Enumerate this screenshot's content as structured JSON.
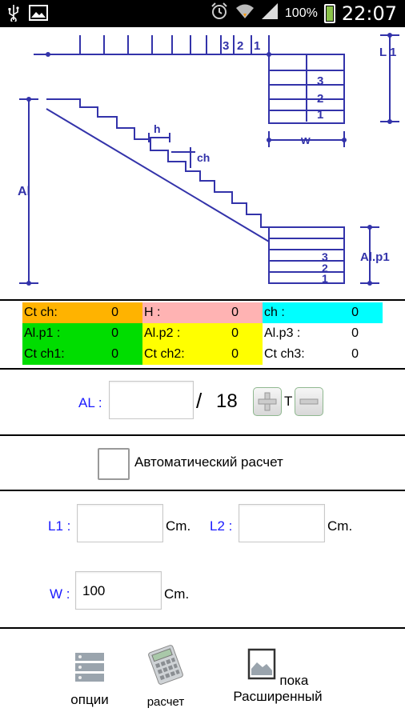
{
  "status_bar": {
    "battery": "100%",
    "time": "22:07",
    "icons": [
      "usb-icon",
      "image-icon",
      "alarm-icon",
      "wifi-icon",
      "signal-icon",
      "battery-icon"
    ]
  },
  "diagram": {
    "labels": {
      "L1": "L 1",
      "w": "w",
      "h": "h",
      "ch": "ch",
      "Al": "Al",
      "Alp1": "Al.p1",
      "top_steps": [
        "3",
        "2",
        "1"
      ],
      "right_steps": [
        "3",
        "2",
        "1"
      ],
      "bottom_steps": [
        "3",
        "2",
        "1"
      ]
    },
    "color": "#3333aa"
  },
  "table": {
    "rows": [
      [
        {
          "label": "Ct ch:",
          "value": "0",
          "bg": "#ffb300"
        },
        {
          "label": "H :",
          "value": "0",
          "bg": "#ffb3b3"
        },
        {
          "label": "ch :",
          "value": "0",
          "bg": "#00ffff"
        }
      ],
      [
        {
          "label": "Al.p1 :",
          "value": "0",
          "bg": "#00dd00"
        },
        {
          "label": "Al.p2 :",
          "value": "0",
          "bg": "#ffff00"
        },
        {
          "label": "Al.p3 :",
          "value": "0",
          "bg": "#ffffff"
        }
      ],
      [
        {
          "label": "Ct ch1:",
          "value": "0",
          "bg": "#00dd00"
        },
        {
          "label": "Ct ch2:",
          "value": "0",
          "bg": "#ffff00"
        },
        {
          "label": "Ct ch3:",
          "value": "0",
          "bg": "#ffffff"
        }
      ]
    ]
  },
  "al_section": {
    "label": "AL :",
    "value": "",
    "slash": "/",
    "total": "18",
    "t_label": "T"
  },
  "auto_calc": {
    "label": "Автоматический расчет",
    "checked": false
  },
  "dimensions": {
    "l1_label": "L1 :",
    "l1_value": "",
    "l1_unit": "Cm.",
    "l2_label": "L2 :",
    "l2_value": "",
    "l2_unit": "Cm.",
    "w_label": "W :",
    "w_value": "100",
    "w_unit": "Cm."
  },
  "bottom_bar": {
    "options_label": "опции",
    "calc_label": "расчет",
    "advanced_label": "пока Расширенный"
  }
}
